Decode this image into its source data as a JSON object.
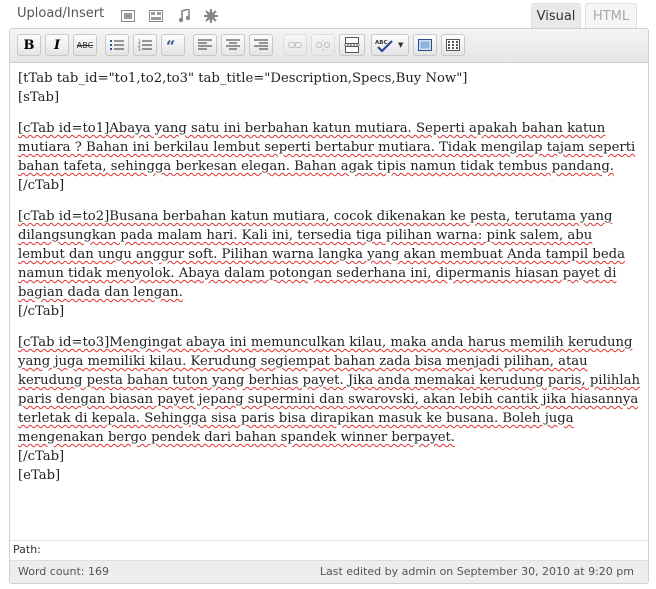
{
  "media_bar": {
    "upload_label": "Upload/Insert",
    "icons": [
      "image-icon",
      "video-icon",
      "audio-icon",
      "media-icon"
    ]
  },
  "tabs": {
    "visual": "Visual",
    "html": "HTML"
  },
  "toolbar": {
    "bold": "B",
    "italic": "I",
    "strikethrough": "ABC"
  },
  "content": {
    "tabs_open": "[tTab tab_id=\"to1,to2,to3\" tab_title=\"Description,Specs,Buy Now\"]",
    "stab": "[sTab]",
    "block1": "[cTab id=to1]Abaya yang satu ini berbahan katun mutiara.  Seperti apakah bahan katun mutiara ? Bahan ini berkilau lembut seperti bertabur mutiara.  Tidak mengilap tajam seperti bahan tafeta, sehingga berkesan elegan.  Bahan agak tipis namun tidak tembus pandang.",
    "close1": "[/cTab]",
    "block2": "[cTab id=to2]Busana berbahan katun mutiara, cocok dikenakan ke pesta, terutama yang dilangsungkan pada malam hari. Kali ini, tersedia tiga pilihan warna: pink salem, abu lembut dan ungu anggur soft.  Pilihan warna langka yang akan membuat Anda tampil beda namun tidak menyolok.  Abaya dalam potongan sederhana ini, dipermanis hiasan payet di bagian dada dan lengan.",
    "close2": "[/cTab]",
    "block3": "[cTab id=to3]Mengingat abaya ini memunculkan kilau, maka anda harus memilih kerudung yang juga memiliki kilau.  Kerudung segiempat bahan zada bisa menjadi pilihan, atau kerudung pesta bahan tuton yang berhias payet.  Jika anda memakai kerudung paris, pilihlah paris dengan biasan payet jepang supermini dan swarovski, akan lebih cantik jika hiasannya terletak di kepala.  Sehingga sisa paris bisa dirapikan masuk ke busana.  Boleh juga mengenakan bergo pendek dari bahan spandek winner berpayet.",
    "close3": "[/cTab]",
    "etab": "[eTab]"
  },
  "path_label": "Path:",
  "word_count": "Word count: 169",
  "last_edited": "Last edited by admin on September 30, 2010 at 9:20 pm"
}
